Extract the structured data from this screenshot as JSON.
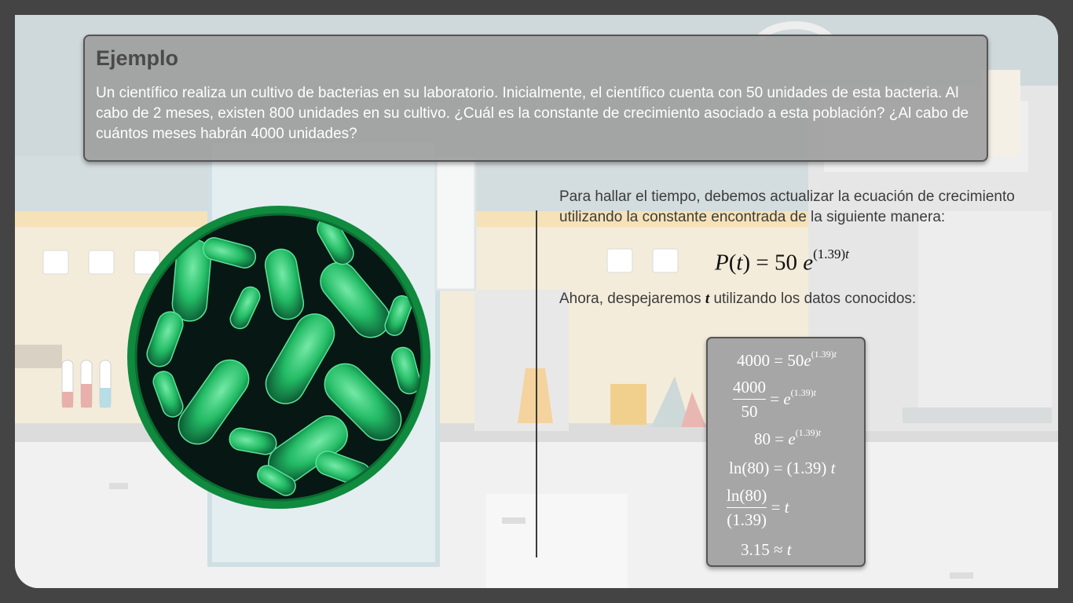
{
  "example": {
    "title": "Ejemplo",
    "text": "Un científico realiza un cultivo de bacterias en su laboratorio. Inicialmente, el científico cuenta con 50 unidades de esta bacteria. Al cabo de 2 meses, existen 800 unidades en su cultivo. ¿Cuál es la constante de crecimiento asociado a esta población? ¿Al cabo de cuántos meses habrán 4000 unidades?"
  },
  "explanation": {
    "paragraph1": "Para hallar el tiempo, debemos actualizar la ecuación de crecimiento utilizando la constante encontrada de la siguiente manera:",
    "equation": {
      "lhs": "P",
      "var": "t",
      "coef": "50",
      "base": "e",
      "exponent": "(1.39)",
      "exp_var": "t"
    },
    "paragraph2_before": "Ahora, despejaremos ",
    "paragraph2_var": "t",
    "paragraph2_after": " utilizando los datos conocidos:"
  },
  "steps": {
    "s1_lhs": "4000",
    "s1_rhs": "50",
    "s1_exp": "(1.39)",
    "s2_num": "4000",
    "s2_den": "50",
    "s2_exp": "(1.39)",
    "s3_lhs": "80",
    "s3_exp": "(1.39)",
    "s4_lhs": "ln(80)",
    "s4_k": "1.39",
    "s5_num": "ln(80)",
    "s5_den": "(1.39)",
    "s6_val": "3.15",
    "var": "t",
    "base": "e"
  },
  "colors": {
    "card_bg": "#a0a0a0",
    "card_border": "#555555",
    "bacteria": "#2ee07a",
    "ring": "#0f8a3e",
    "frame": "#444444"
  }
}
